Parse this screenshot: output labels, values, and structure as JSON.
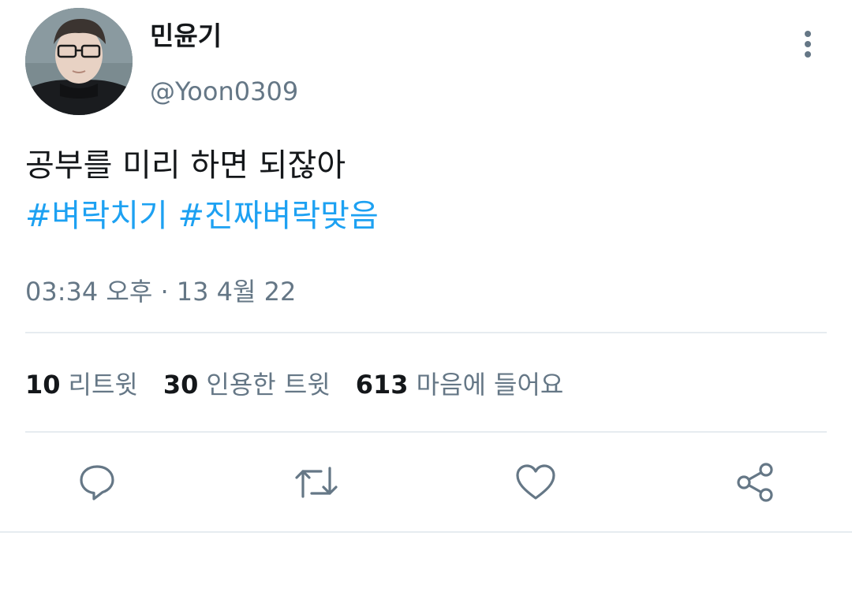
{
  "user": {
    "display_name": "민윤기",
    "handle": "@Yoon0309",
    "avatar_icon": "profile-photo"
  },
  "tweet": {
    "text": "공부를 미리 하면 되잖아",
    "hashtags": [
      "#벼락치기",
      "#진짜벼락맞음"
    ],
    "timestamp": "03:34 오후 · 13 4월 22"
  },
  "stats": {
    "retweets": {
      "count": "10",
      "label": "리트윗"
    },
    "quotes": {
      "count": "30",
      "label": "인용한 트윗"
    },
    "likes": {
      "count": "613",
      "label": "마음에 들어요"
    }
  },
  "actions": {
    "reply_icon": "speech-bubble-icon",
    "retweet_icon": "retweet-arrows-icon",
    "like_icon": "heart-icon",
    "share_icon": "share-nodes-icon",
    "more_icon": "vertical-ellipsis-icon"
  },
  "colors": {
    "text_primary": "#14171a",
    "text_secondary": "#657786",
    "link": "#1da1f2",
    "divider": "#e6ecf0"
  }
}
